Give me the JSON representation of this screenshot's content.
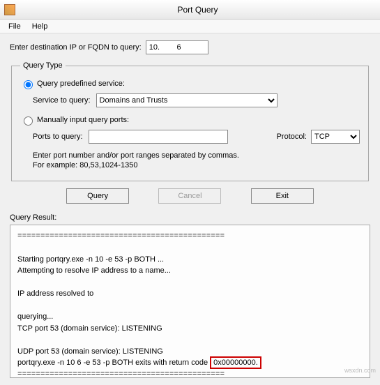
{
  "window": {
    "title": "Port Query"
  },
  "menu": {
    "file": "File",
    "help": "Help"
  },
  "dest": {
    "label": "Enter destination IP or FQDN to query:",
    "value": "10.        6"
  },
  "group": {
    "legend": "Query Type",
    "predef_label": "Query predefined service:",
    "service_label": "Service to query:",
    "service_value": "Domains and Trusts",
    "manual_label": "Manually input query ports:",
    "ports_label": "Ports to query:",
    "ports_value": "",
    "protocol_label": "Protocol:",
    "protocol_value": "TCP",
    "help1": "Enter port number and/or port ranges separated by commas.",
    "help2": "For example: 80,53,1024-1350"
  },
  "buttons": {
    "query": "Query",
    "cancel": "Cancel",
    "exit": "Exit"
  },
  "result": {
    "label": "Query Result:",
    "divider": "=============================================",
    "line1": " Starting portqry.exe -n 10            -e 53 -p BOTH ...",
    "line2": "Attempting to resolve IP address to a name...",
    "line3": "IP address resolved to",
    "line4": "querying...",
    "line5": "TCP port 53 (domain service): LISTENING",
    "line6": "UDP port 53 (domain service): LISTENING",
    "line7a": "portqry.exe -n 10        6 -e 53 -p BOTH exits with return code",
    "line7b": "0x00000000.",
    "divider2": "============================================="
  },
  "watermark": "wsxdn.com"
}
